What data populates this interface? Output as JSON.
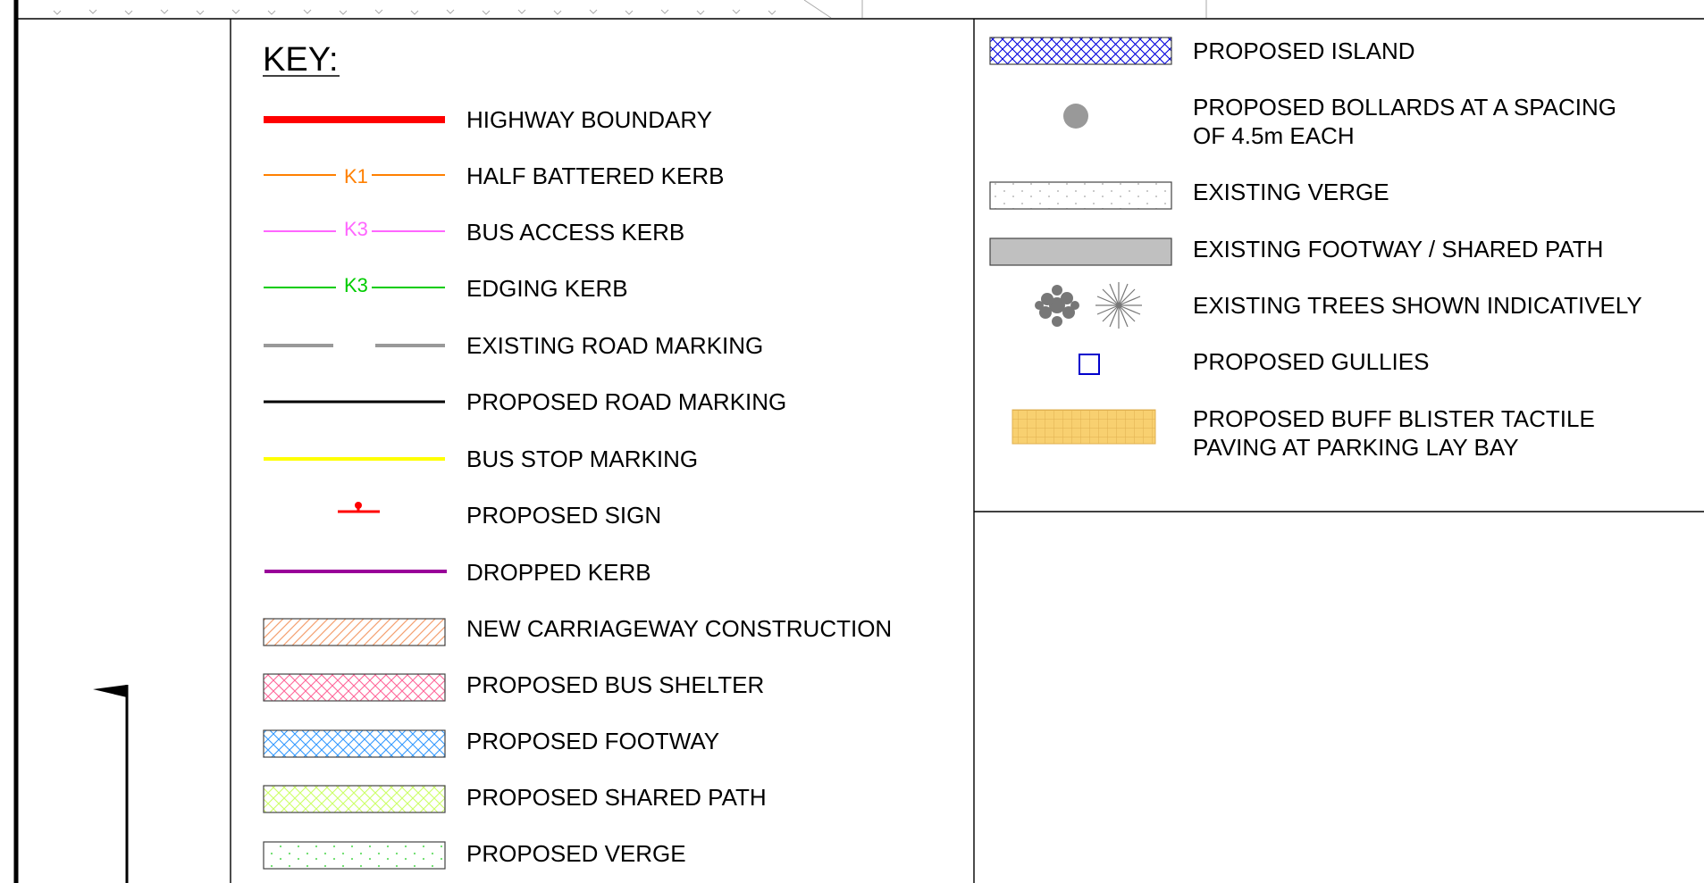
{
  "key_title": "KEY:",
  "left_column": [
    {
      "label": "HIGHWAY BOUNDARY",
      "symbol": "line",
      "color": "#ff0000"
    },
    {
      "label": "HALF BATTERED KERB",
      "symbol": "coded-line",
      "code": "K1",
      "color": "#ff8000"
    },
    {
      "label": "BUS ACCESS KERB",
      "symbol": "coded-line",
      "code": "K3",
      "color": "#ff66ff"
    },
    {
      "label": "EDGING KERB",
      "symbol": "coded-line",
      "code": "K3",
      "color": "#00cc00"
    },
    {
      "label": "EXISTING ROAD MARKING",
      "symbol": "dashed-line",
      "color": "#999999"
    },
    {
      "label": "PROPOSED ROAD MARKING",
      "symbol": "line",
      "color": "#000000"
    },
    {
      "label": "BUS STOP MARKING",
      "symbol": "line",
      "color": "#ffff00"
    },
    {
      "label": "PROPOSED SIGN",
      "symbol": "sign",
      "color": "#ff0000"
    },
    {
      "label": "DROPPED KERB",
      "symbol": "line",
      "color": "#990099"
    },
    {
      "label": "NEW CARRIAGEWAY CONSTRUCTION",
      "symbol": "hatch-single",
      "color": "#f4a070"
    },
    {
      "label": "PROPOSED BUS SHELTER",
      "symbol": "hatch-cross",
      "color": "#ff6699"
    },
    {
      "label": "PROPOSED FOOTWAY",
      "symbol": "hatch-cross",
      "color": "#3399ff"
    },
    {
      "label": "PROPOSED SHARED PATH",
      "symbol": "hatch-cross",
      "color": "#ccff66"
    },
    {
      "label": "PROPOSED VERGE",
      "symbol": "dotted-fill",
      "color": "#66dd66"
    }
  ],
  "right_column": [
    {
      "lines": [
        "PROPOSED ISLAND"
      ],
      "symbol": "hatch-cross",
      "color": "#0000dd"
    },
    {
      "lines": [
        "PROPOSED BOLLARDS AT A SPACING",
        "OF 4.5m EACH"
      ],
      "symbol": "bollard",
      "color": "#999999"
    },
    {
      "lines": [
        "EXISTING VERGE"
      ],
      "symbol": "dotted-fill",
      "color": "#cccccc"
    },
    {
      "lines": [
        "EXISTING FOOTWAY / SHARED PATH"
      ],
      "symbol": "solid-fill",
      "color": "#c0c0c0"
    },
    {
      "lines": [
        "EXISTING TREES SHOWN INDICATIVELY"
      ],
      "symbol": "trees",
      "color": "#777777"
    },
    {
      "lines": [
        "PROPOSED GULLIES"
      ],
      "symbol": "gully",
      "color": "#0000cc"
    },
    {
      "lines": [
        "PROPOSED BUFF BLISTER TACTILE",
        "PAVING AT PARKING LAY BAY"
      ],
      "symbol": "tactile",
      "color": "#f8d070"
    }
  ]
}
